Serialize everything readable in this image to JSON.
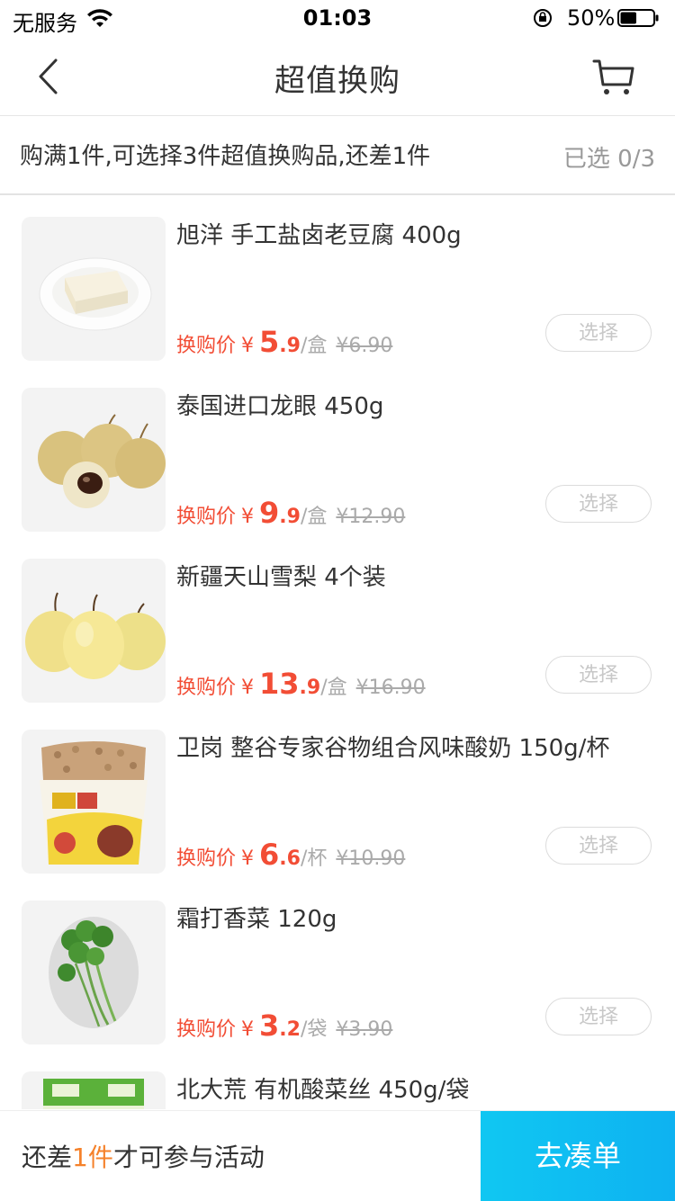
{
  "status_bar": {
    "carrier": "无服务",
    "time": "01:03",
    "battery_percent": "50%",
    "battery_level": 0.5
  },
  "nav": {
    "title": "超值换购",
    "back_icon": "chevron-left-icon",
    "cart_icon": "cart-icon"
  },
  "promo": {
    "text": "购满1件,可选择3件超值换购品,还差1件",
    "selected": "已选 0/3"
  },
  "items": [
    {
      "title": "旭洋 手工盐卤老豆腐 400g",
      "price_label": "换购价",
      "yen": "¥",
      "price_int": "5",
      "price_dec": ".9",
      "unit": "/盒",
      "original": "¥6.90",
      "button": "选择"
    },
    {
      "title": "泰国进口龙眼 450g",
      "price_label": "换购价",
      "yen": "¥",
      "price_int": "9",
      "price_dec": ".9",
      "unit": "/盒",
      "original": "¥12.90",
      "button": "选择"
    },
    {
      "title": "新疆天山雪梨 4个装",
      "price_label": "换购价",
      "yen": "¥",
      "price_int": "13",
      "price_dec": ".9",
      "unit": "/盒",
      "original": "¥16.90",
      "button": "选择"
    },
    {
      "title": "卫岗 整谷专家谷物组合风味酸奶 150g/杯",
      "price_label": "换购价",
      "yen": "¥",
      "price_int": "6",
      "price_dec": ".6",
      "unit": "/杯",
      "original": "¥10.90",
      "button": "选择"
    },
    {
      "title": "霜打香菜 120g",
      "price_label": "换购价",
      "yen": "¥",
      "price_int": "3",
      "price_dec": ".2",
      "unit": "/袋",
      "original": "¥3.90",
      "button": "选择"
    },
    {
      "title": "北大荒 有机酸菜丝 450g/袋"
    }
  ],
  "bottom": {
    "text_before": "还差",
    "text_highlight": "1件",
    "text_after": "才可参与活动",
    "button": "去凑单"
  },
  "colors": {
    "price": "#f24d35",
    "highlight": "#f5812a",
    "button_bg": "#0eb2f1"
  }
}
